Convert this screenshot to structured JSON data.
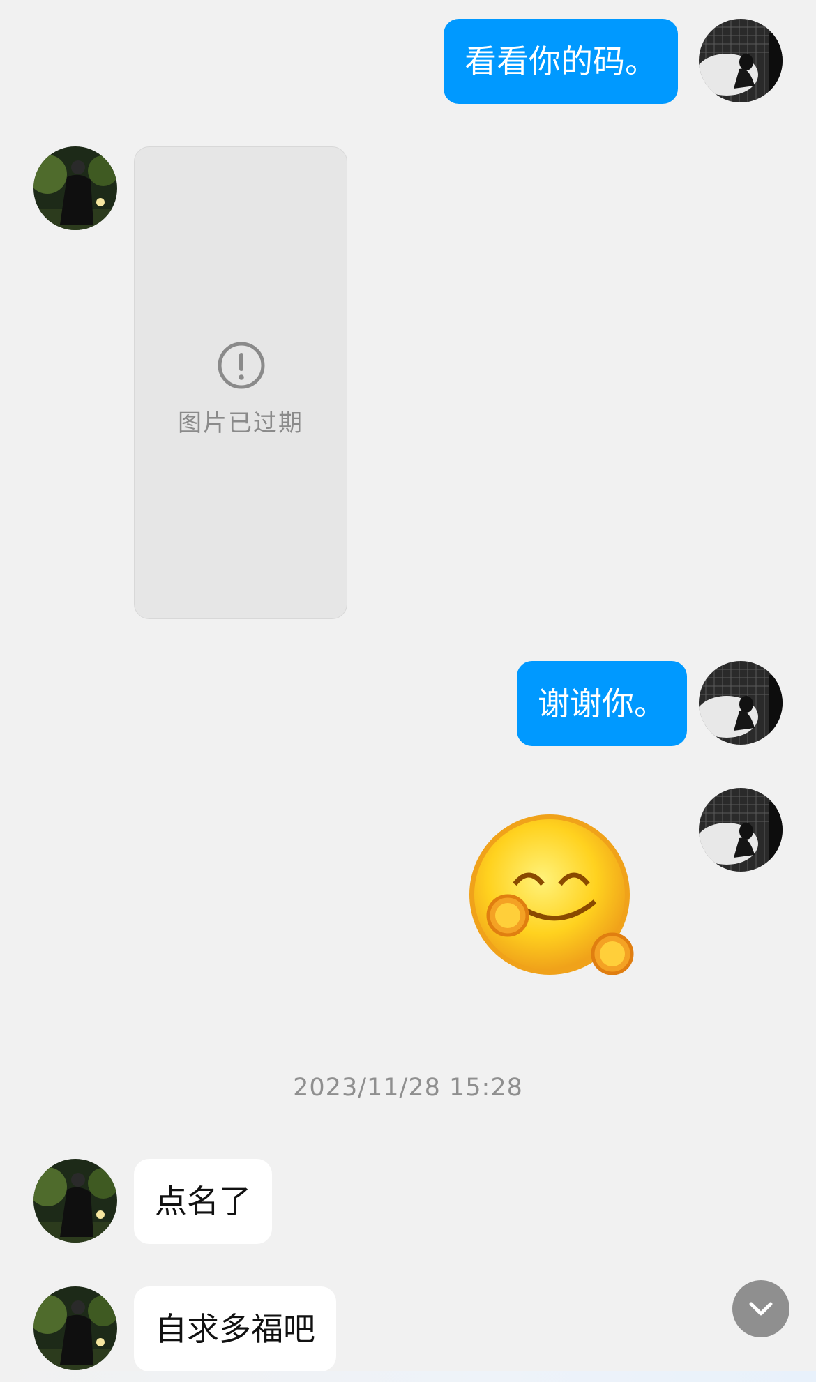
{
  "messages": {
    "m1": {
      "text": "看看你的码。"
    },
    "m2": {
      "expired_label": "图片已过期"
    },
    "m3": {
      "text": "谢谢你。"
    },
    "m4": {
      "emoji": "smiling-blush-emoji"
    },
    "timestamp": "2023/11/28 15:28",
    "m5": {
      "text": "点名了"
    },
    "m6": {
      "text": "自求多福吧"
    }
  },
  "colors": {
    "outgoing_bubble": "#0099ff",
    "incoming_bubble": "#ffffff",
    "background": "#f1f1f1"
  },
  "icons": [
    "alert-circle-icon",
    "chevron-down-icon"
  ]
}
